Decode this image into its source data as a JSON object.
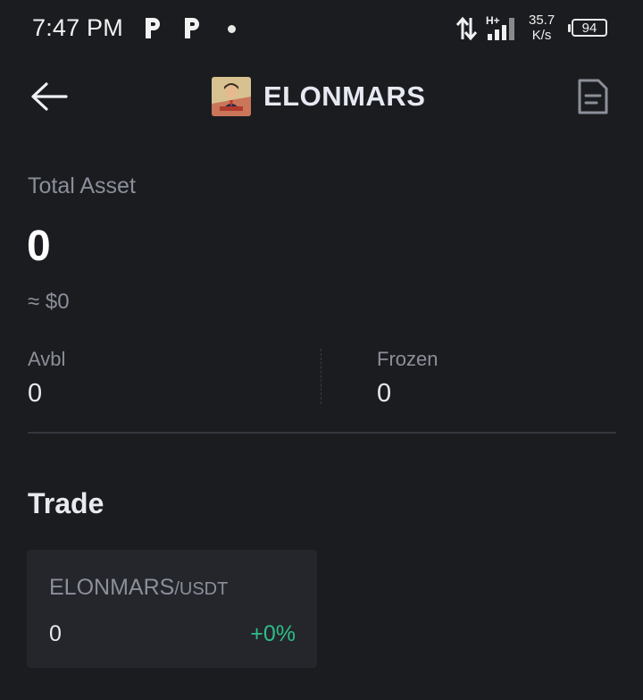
{
  "status_bar": {
    "time": "7:47 PM",
    "notification_icons": [
      "p-app-icon",
      "p-app-icon",
      "dot-icon"
    ],
    "network_type": "H+",
    "net_speed_value": "35.7",
    "net_speed_unit": "K/s",
    "battery": "94"
  },
  "header": {
    "title": "ELONMARS",
    "back_icon": "arrow-left-icon",
    "doc_icon": "document-icon"
  },
  "asset": {
    "total_label": "Total Asset",
    "total_value": "0",
    "approx_value": "≈ $0",
    "avbl_label": "Avbl",
    "avbl_value": "0",
    "frozen_label": "Frozen",
    "frozen_value": "0"
  },
  "trade": {
    "heading": "Trade",
    "pair_base": "ELONMARS",
    "pair_quote": "/USDT",
    "price": "0",
    "change": "+0%"
  },
  "colors": {
    "background": "#1b1c20",
    "card": "#24262c",
    "muted_text": "#8b8f99",
    "positive": "#2ebd85"
  }
}
